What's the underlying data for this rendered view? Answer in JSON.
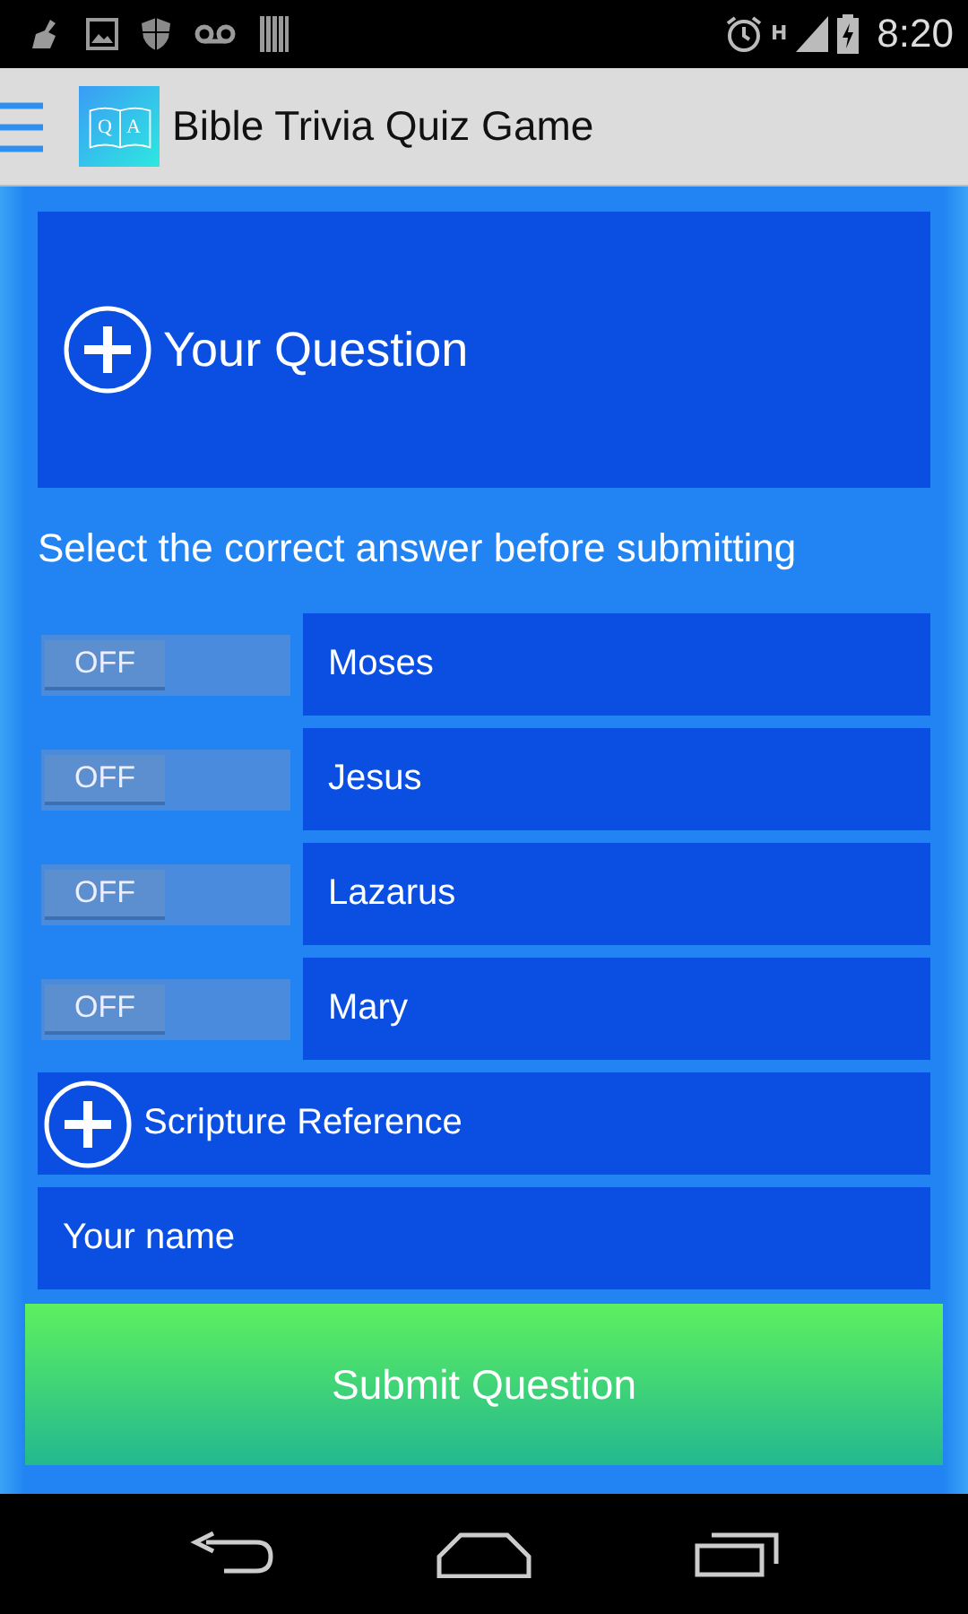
{
  "status_bar": {
    "network_type": "H",
    "time": "8:20"
  },
  "app_bar": {
    "logo_letters": [
      "Q",
      "A"
    ],
    "title": "Bible Trivia Quiz Game"
  },
  "question": {
    "label": "Your Question"
  },
  "instruction": "Select the correct answer before submitting",
  "answers": [
    {
      "toggle_label": "OFF",
      "checked": false,
      "value": "Moses"
    },
    {
      "toggle_label": "OFF",
      "checked": false,
      "value": "Jesus"
    },
    {
      "toggle_label": "OFF",
      "checked": false,
      "value": "Lazarus"
    },
    {
      "toggle_label": "OFF",
      "checked": false,
      "value": "Mary"
    }
  ],
  "scripture": {
    "label": "Scripture Reference"
  },
  "name_field": {
    "placeholder": "Your name"
  },
  "submit_button": "Submit Question"
}
